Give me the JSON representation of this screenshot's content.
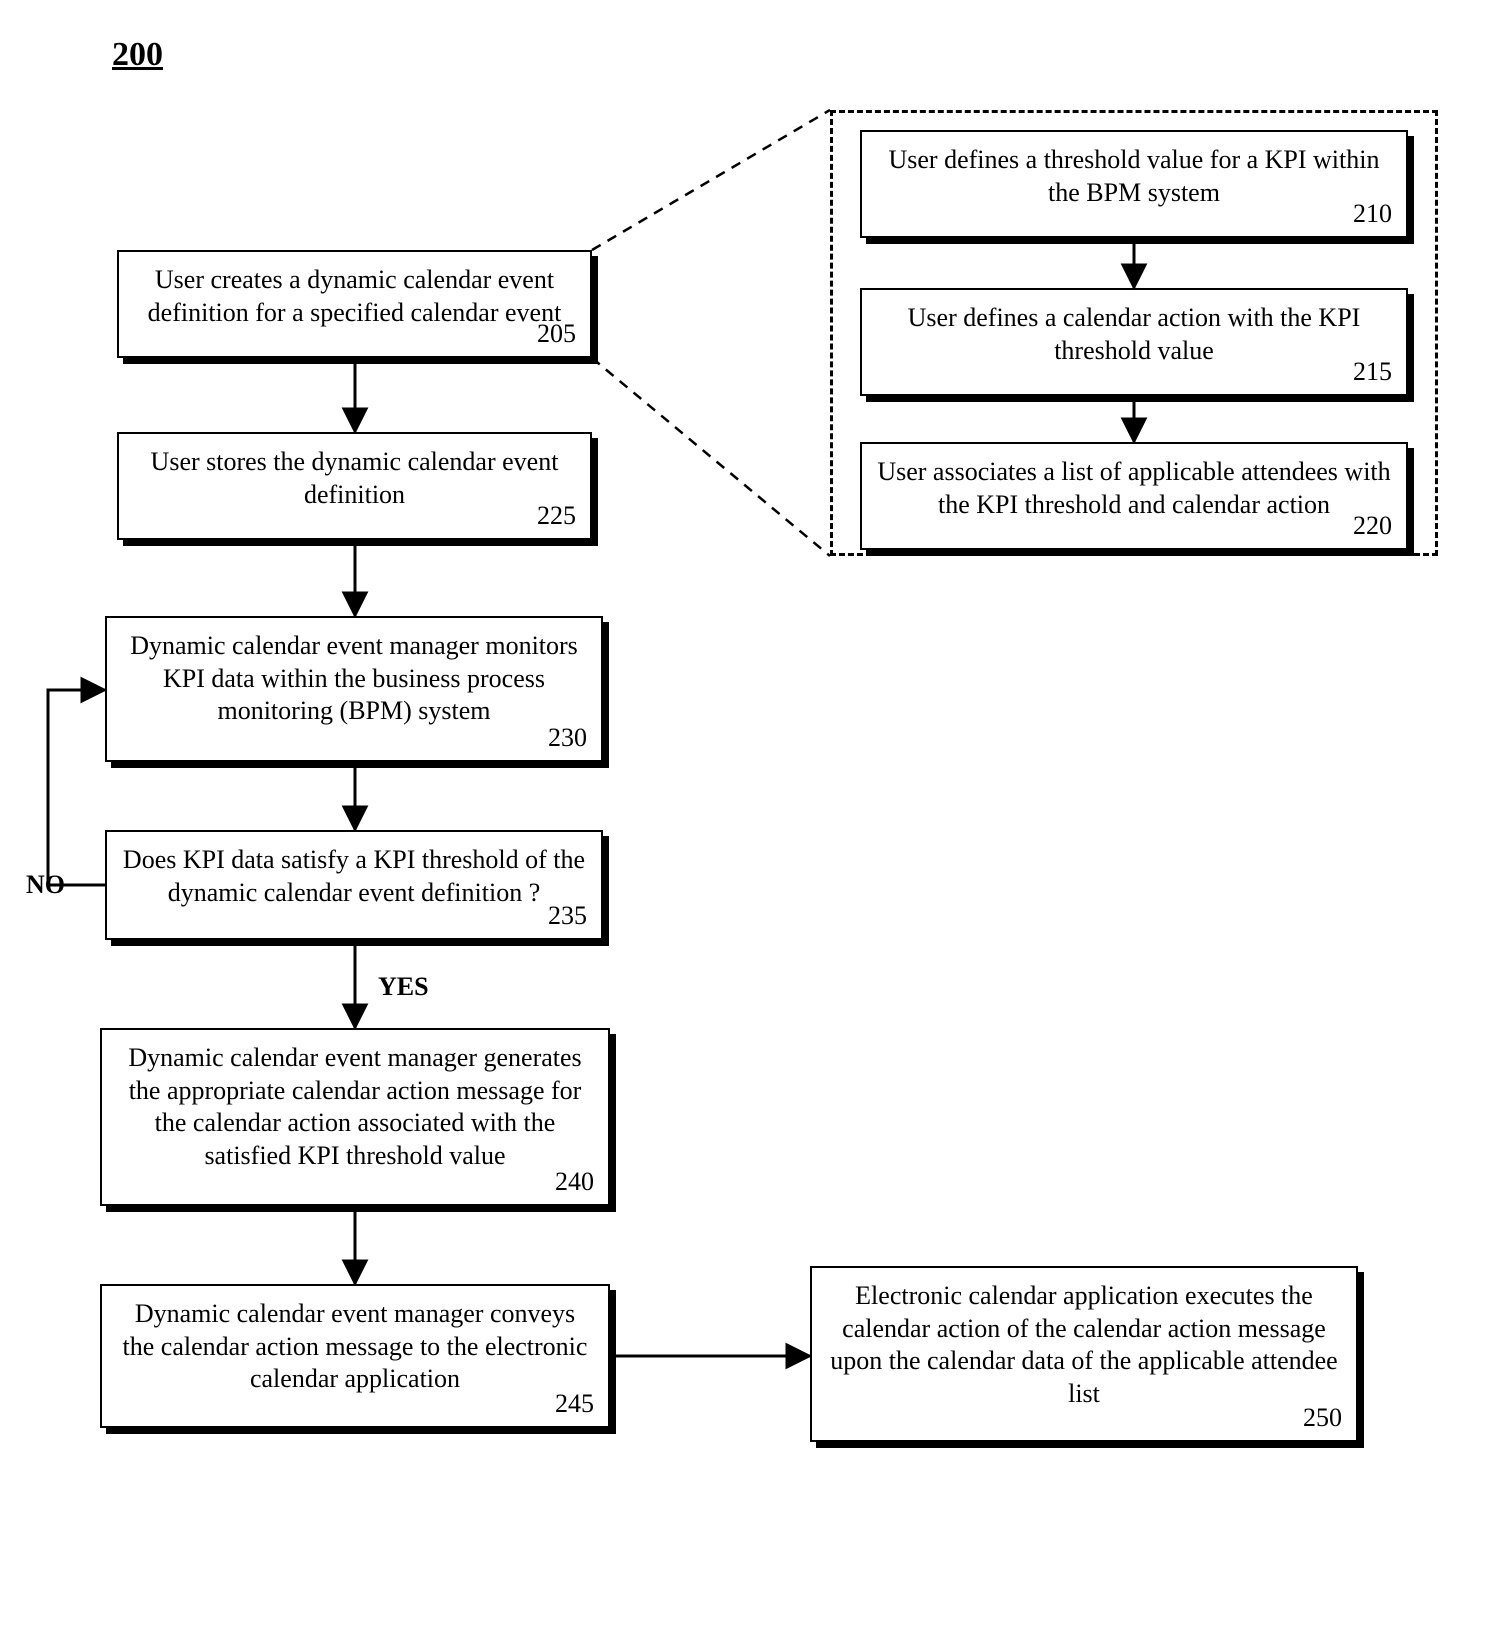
{
  "figure_ref": "200",
  "boxes": {
    "b205": {
      "text": "User creates a dynamic calendar event definition for a specified calendar event",
      "ref": "205"
    },
    "b210": {
      "text": "User defines a threshold value for a KPI within the BPM system",
      "ref": "210"
    },
    "b215": {
      "text": "User defines a calendar action with the KPI threshold value",
      "ref": "215"
    },
    "b220": {
      "text": "User associates a list of applicable attendees with the KPI threshold and calendar action",
      "ref": "220"
    },
    "b225": {
      "text": "User stores the dynamic calendar event definition",
      "ref": "225"
    },
    "b230": {
      "text": "Dynamic calendar event manager monitors KPI data within the business process monitoring (BPM) system",
      "ref": "230"
    },
    "b235": {
      "text": "Does KPI data satisfy a KPI threshold of the dynamic calendar event definition ?",
      "ref": "235"
    },
    "b240": {
      "text": "Dynamic calendar event manager generates the appropriate calendar action message for the calendar action associated with the satisfied KPI threshold value",
      "ref": "240"
    },
    "b245": {
      "text": "Dynamic calendar event manager conveys the calendar action message to the electronic calendar application",
      "ref": "245"
    },
    "b250": {
      "text": "Electronic calendar application executes the calendar action of the calendar action message upon the calendar data of the applicable attendee list",
      "ref": "250"
    }
  },
  "labels": {
    "no": "NO",
    "yes": "YES"
  }
}
